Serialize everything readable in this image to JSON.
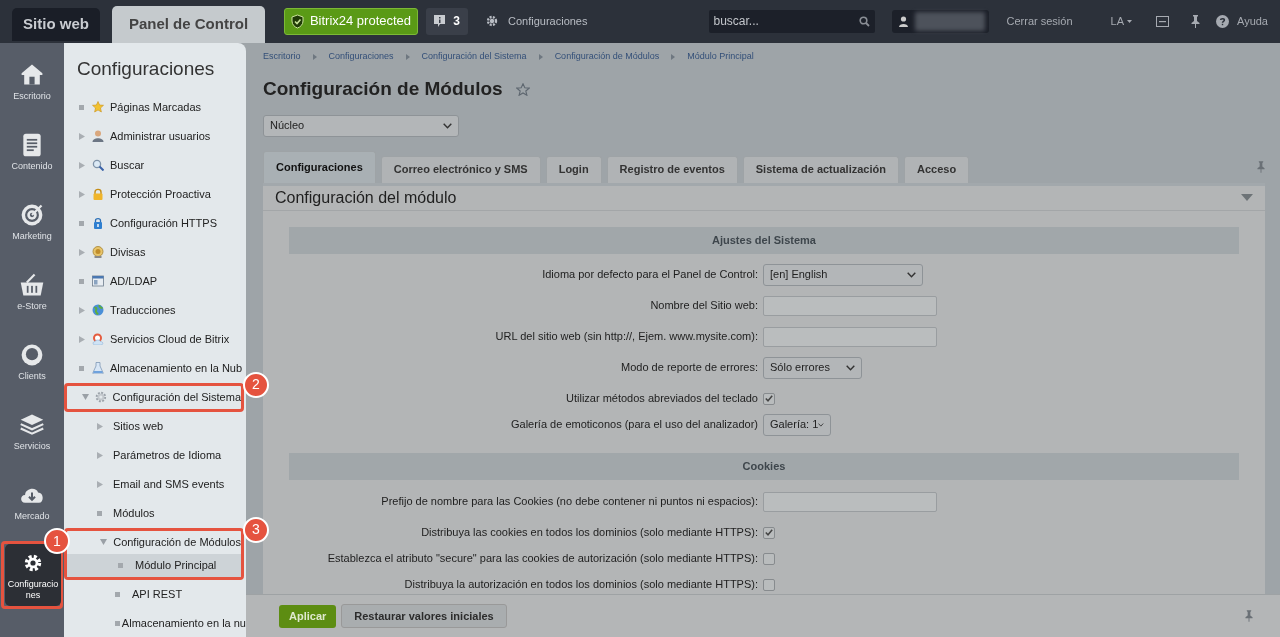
{
  "top_bar": {
    "tabs": [
      {
        "label": "Sitio web",
        "selected": false
      },
      {
        "label": "Panel de Control",
        "selected": true
      }
    ],
    "protected_button": "Bitrix24 protected",
    "notifications": "3",
    "settings_link": "Configuraciones",
    "search": {
      "placeholder": "buscar..."
    },
    "logout": "Cerrar sesión",
    "language": "LA",
    "help": "Ayuda"
  },
  "rail": [
    {
      "label": "Escritorio",
      "selected": false
    },
    {
      "label": "Contenido",
      "selected": false
    },
    {
      "label": "Marketing",
      "selected": false
    },
    {
      "label": "e-Store",
      "selected": false
    },
    {
      "label": "Clients",
      "selected": false
    },
    {
      "label": "Servicios",
      "selected": false
    },
    {
      "label": "Mercado",
      "selected": false
    },
    {
      "label": "Configuraciones",
      "selected": true,
      "callout": "1"
    }
  ],
  "menu": {
    "title": "Configuraciones",
    "items": [
      {
        "label": "Páginas Marcadas",
        "kind": "leaf"
      },
      {
        "label": "Administrar usuarios",
        "kind": "folder",
        "expanded": false
      },
      {
        "label": "Buscar",
        "kind": "folder",
        "expanded": false
      },
      {
        "label": "Protección Proactiva",
        "kind": "folder",
        "expanded": false
      },
      {
        "label": "Configuración HTTPS",
        "kind": "leaf"
      },
      {
        "label": "Divisas",
        "kind": "folder",
        "expanded": false
      },
      {
        "label": "AD/LDAP",
        "kind": "leaf"
      },
      {
        "label": "Traducciones",
        "kind": "folder",
        "expanded": false
      },
      {
        "label": "Servicios Cloud de Bitrix",
        "kind": "folder",
        "expanded": false
      },
      {
        "label": "Almacenamiento en la Nub",
        "kind": "leaf"
      },
      {
        "label": "Configuración del Sistema",
        "kind": "folder",
        "expanded": true,
        "callout": "2",
        "children": [
          {
            "label": "Sitios web",
            "kind": "folder",
            "expanded": false
          },
          {
            "label": "Parámetros de Idioma",
            "kind": "folder",
            "expanded": false
          },
          {
            "label": "Email and SMS events",
            "kind": "folder",
            "expanded": false
          },
          {
            "label": "Módulos",
            "kind": "leaf"
          },
          {
            "label": "Configuración de Módulos",
            "kind": "folder",
            "expanded": true,
            "callout": "3",
            "children": [
              {
                "label": "Módulo Principal",
                "kind": "leaf",
                "selected": true,
                "framed": true
              },
              {
                "label": "API REST",
                "kind": "leaf",
                "selected": false,
                "framed": false
              },
              {
                "label": "Almacenamiento en la nu",
                "kind": "leaf",
                "selected": false,
                "framed": false
              }
            ]
          }
        ]
      }
    ]
  },
  "breadcrumbs": [
    "Escritorio",
    "Configuraciones",
    "Configuración del Sistema",
    "Configuración de Módulos",
    "Módulo Principal"
  ],
  "page_title": "Configuración de Módulos",
  "module_select": "Núcleo",
  "tabs": [
    {
      "label": "Configuraciones",
      "selected": true
    },
    {
      "label": "Correo electrónico y SMS",
      "selected": false
    },
    {
      "label": "Login",
      "selected": false
    },
    {
      "label": "Registro de eventos",
      "selected": false
    },
    {
      "label": "Sistema de actualización",
      "selected": false
    },
    {
      "label": "Acceso",
      "selected": false
    }
  ],
  "panel_title": "Configuración del módulo",
  "sections": [
    {
      "title": "Ajustes del Sistema",
      "rows": [
        {
          "kind": "select",
          "label": "Idioma por defecto para el Panel de Control:",
          "value": "[en] English"
        },
        {
          "kind": "text",
          "label": "Nombre del Sitio web:"
        },
        {
          "kind": "text",
          "label": "URL del sitio web (sin http://, Ejem. www.mysite.com):"
        },
        {
          "kind": "select",
          "label": "Modo de reporte de errores:",
          "value": "Sólo errores"
        },
        {
          "kind": "checkbox",
          "label": "Utilizar métodos abreviados del teclado",
          "checked": true
        },
        {
          "kind": "select",
          "label": "Galería de emoticonos (para el uso del analizador)",
          "value": "Galería: 1"
        }
      ]
    },
    {
      "title": "Cookies",
      "rows": [
        {
          "kind": "text",
          "label": "Prefijo de nombre para las Cookies (no debe contener ni puntos ni espacios):"
        },
        {
          "kind": "checkbox",
          "label": "Distribuya las cookies en todos los dominios (solo mediante HTTPS):",
          "checked": true
        },
        {
          "kind": "checkbox",
          "label": "Establezca el atributo \"secure\" para las cookies de autorización (solo mediante HTTPS):",
          "checked": false
        },
        {
          "kind": "checkbox",
          "label": "Distribuya la autorización en todos los dominios (solo mediante HTTPS):",
          "checked": false
        }
      ]
    }
  ],
  "buttons": [
    {
      "label": "Aplicar",
      "kind": "primary"
    },
    {
      "label": "Restaurar valores iniciales",
      "kind": "secondary"
    }
  ]
}
